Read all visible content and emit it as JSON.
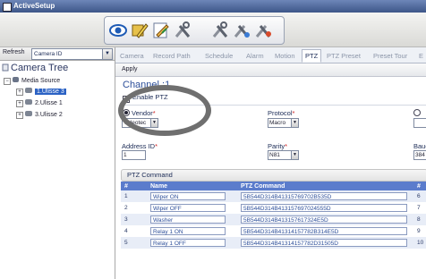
{
  "app": {
    "title": "ActiveSetup"
  },
  "left": {
    "refresh_label": "Refresh",
    "select_value": "Camera ID",
    "tree_title": "Camera Tree",
    "media_source": "Media Source",
    "items": [
      "1.Ulisse 3",
      "2.Ulisse 1",
      "3.Ulisse 2"
    ]
  },
  "tabs": [
    "Camera",
    "Record Path",
    "Schedule",
    "Alarm",
    "Motion",
    "PTZ",
    "PTZ Preset",
    "Preset Tour",
    "E"
  ],
  "active_tab": "PTZ",
  "apply_label": "Apply",
  "channel_label": "Channel :1",
  "enable_ptz_label": "Enable PTZ",
  "form": {
    "vendor_label": "Vendor",
    "vendor_value": "Videotec",
    "protocol_label": "Protocol",
    "protocol_value": "Macro",
    "address_label": "Address ID",
    "address_value": "1",
    "parity_label": "Parity",
    "parity_value": "N81",
    "baud_label": "Baud",
    "baud_value": "384",
    "required_mark": "*"
  },
  "ptz_command": {
    "section_title": "PTZ Command",
    "columns": [
      "#",
      "Name",
      "PTZ Command",
      "#"
    ],
    "rows": [
      {
        "num": "1",
        "name": "Wiper ON",
        "cmd": "5B544D314B41315769702B535D",
        "num2": "6"
      },
      {
        "num": "2",
        "name": "Wiper OFF",
        "cmd": "5B544D314B413157697024555D",
        "num2": "7"
      },
      {
        "num": "3",
        "name": "Washer",
        "cmd": "5B544D314B413157617324E5D",
        "num2": "8"
      },
      {
        "num": "4",
        "name": "Relay 1 ON",
        "cmd": "5B544D314B41314157782B314E5D",
        "num2": "9"
      },
      {
        "num": "5",
        "name": "Relay 1 OFF",
        "cmd": "5B544D314B41314157782D31505D",
        "num2": "10"
      }
    ]
  },
  "colors": {
    "accent": "#5b7ccc",
    "selected": "#2b62c4",
    "title_bar": "#4a6398"
  }
}
